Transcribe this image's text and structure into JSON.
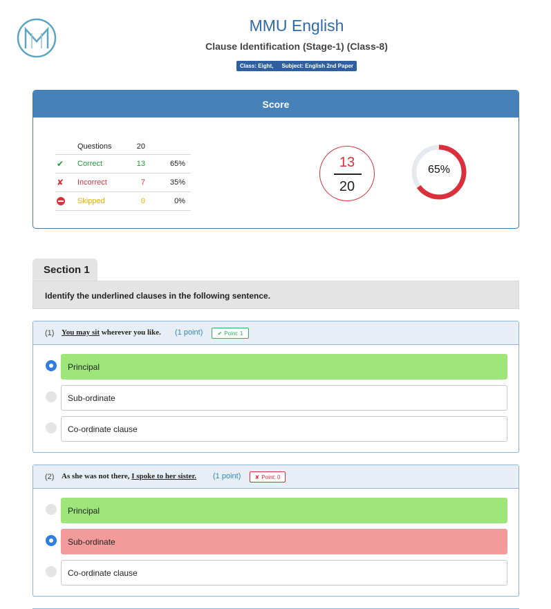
{
  "header": {
    "title": "MMU English",
    "subtitle": "Clause Identification (Stage-1) (Class-8)",
    "class_label": "Class: Eight,",
    "subject_label": "Subject: English 2nd Paper"
  },
  "score": {
    "title": "Score",
    "questions_label": "Questions",
    "questions_count": "20",
    "rows": [
      {
        "icon": "check-icon",
        "label": "Correct",
        "count": "13",
        "pct": "65%"
      },
      {
        "icon": "cross-icon",
        "label": "Incorrect",
        "count": "7",
        "pct": "35%"
      },
      {
        "icon": "no-entry-icon",
        "label": "Skipped",
        "count": "0",
        "pct": "0%"
      }
    ],
    "numerator": "13",
    "denominator": "20",
    "percent_label": "65%",
    "percent_value": 0.65,
    "colors": {
      "accent": "#4681b8",
      "correct": "#1e9a3a",
      "incorrect": "#d9303c",
      "skipped": "#e6b000"
    }
  },
  "section": {
    "tab_label": "Section 1",
    "instruction": "Identify the underlined clauses in the following sentence."
  },
  "questions": [
    {
      "number": "(1)",
      "underlined": "You may sit",
      "text_rest": " wherever you like.",
      "point": "(1 point)",
      "badge_icon": "✔",
      "badge": "Point: 1",
      "options": [
        "Principal",
        "Sub-ordinate",
        "Co-ordinate clause"
      ]
    },
    {
      "number": "(2)",
      "text_before": "As she was not there, ",
      "underlined": "I spoke to her sister.",
      "point": "(1 point)",
      "badge_icon": "✘",
      "badge": "Point: 0",
      "options": [
        "Principal",
        "Sub-ordinate",
        "Co-ordinate clause"
      ]
    }
  ]
}
